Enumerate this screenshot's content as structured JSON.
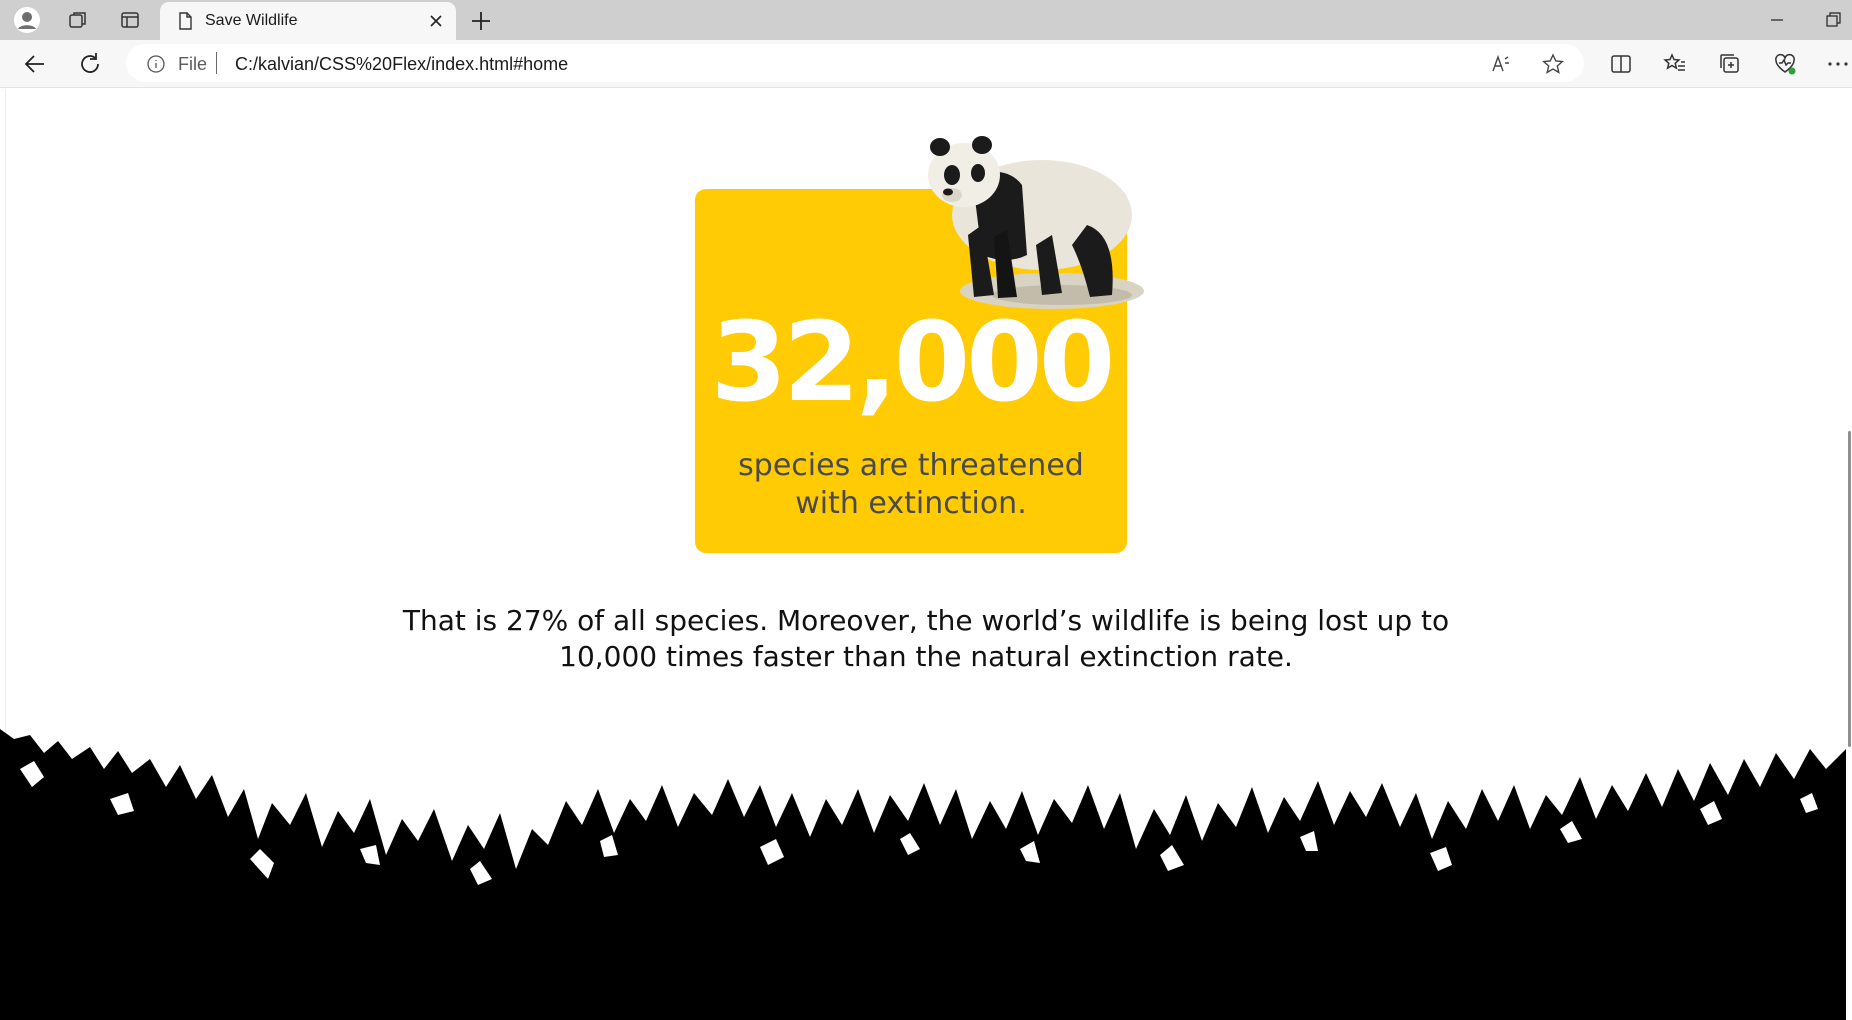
{
  "browser": {
    "tab": {
      "title": "Save Wildlife"
    },
    "address": {
      "scheme": "File",
      "url": "C:/kalvian/CSS%20Flex/index.html#home"
    },
    "icons": {
      "profile": "profile-icon",
      "workspaces": "workspaces-icon",
      "tab_actions": "tab-actions-icon",
      "back": "back-arrow-icon",
      "refresh": "refresh-icon",
      "read_aloud": "read-aloud-icon",
      "favorite": "star-icon",
      "split_screen": "split-screen-icon",
      "favorites": "favorites-icon",
      "collections": "collections-icon",
      "performance": "browser-essentials-icon",
      "menu": "more-icon"
    }
  },
  "page": {
    "stat": {
      "number": "32,000",
      "caption_lines": [
        "species are threatened",
        "with extinction."
      ]
    },
    "body_lines": [
      "That is 27% of all species. Moreover, the world’s wildlife is being lost up to",
      "10,000 times faster than the natural extinction rate."
    ],
    "colors": {
      "card": "#ffcb04",
      "number": "#ffffff",
      "caption": "#4a4a4a",
      "grass": "#000000"
    },
    "images": {
      "hero_animal": "giant-panda",
      "footer": "black-grass-silhouette"
    }
  }
}
